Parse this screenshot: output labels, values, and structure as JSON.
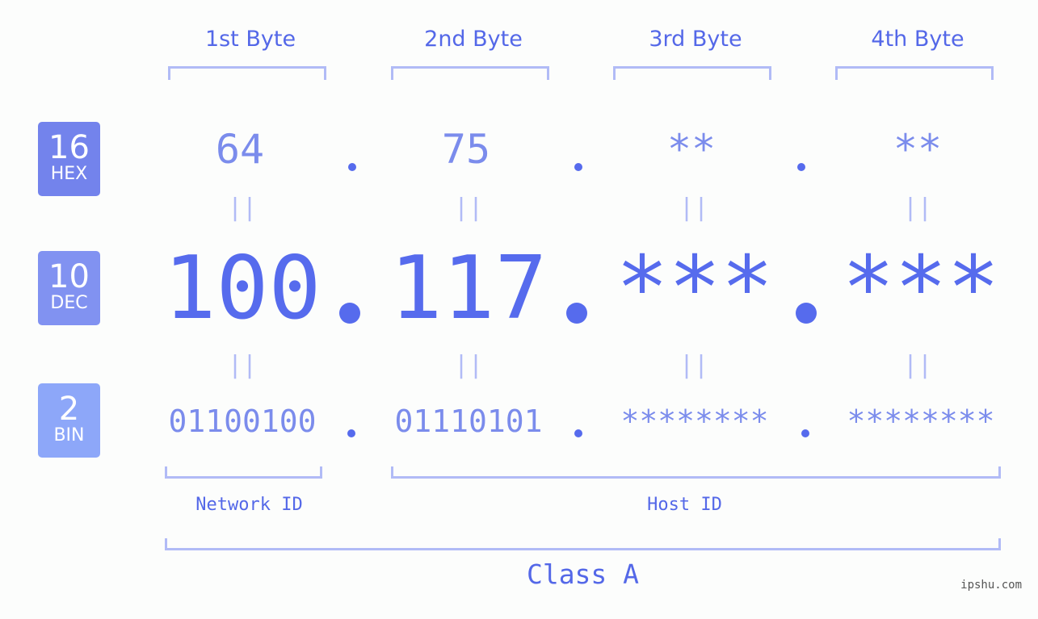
{
  "byte_headers": [
    "1st Byte",
    "2nd Byte",
    "3rd Byte",
    "4th Byte"
  ],
  "badges": {
    "hex": {
      "num": "16",
      "label": "HEX",
      "color": "#7383ec"
    },
    "dec": {
      "num": "10",
      "label": "DEC",
      "color": "#8192f1"
    },
    "bin": {
      "num": "2",
      "label": "BIN",
      "color": "#8da7f9"
    }
  },
  "hex_values": [
    "64",
    "75",
    "**",
    "**"
  ],
  "dec_values": [
    "100",
    "117",
    "***",
    "***"
  ],
  "bin_values": [
    "01100100",
    "01110101",
    "********",
    "********"
  ],
  "equals_sign": "||",
  "segments": {
    "network": "Network ID",
    "host": "Host ID"
  },
  "class_label": "Class A",
  "watermark": "ipshu.com",
  "colors": {
    "accent": "#566bed",
    "light": "#7b8cec",
    "bracket": "#b1bbf6"
  }
}
